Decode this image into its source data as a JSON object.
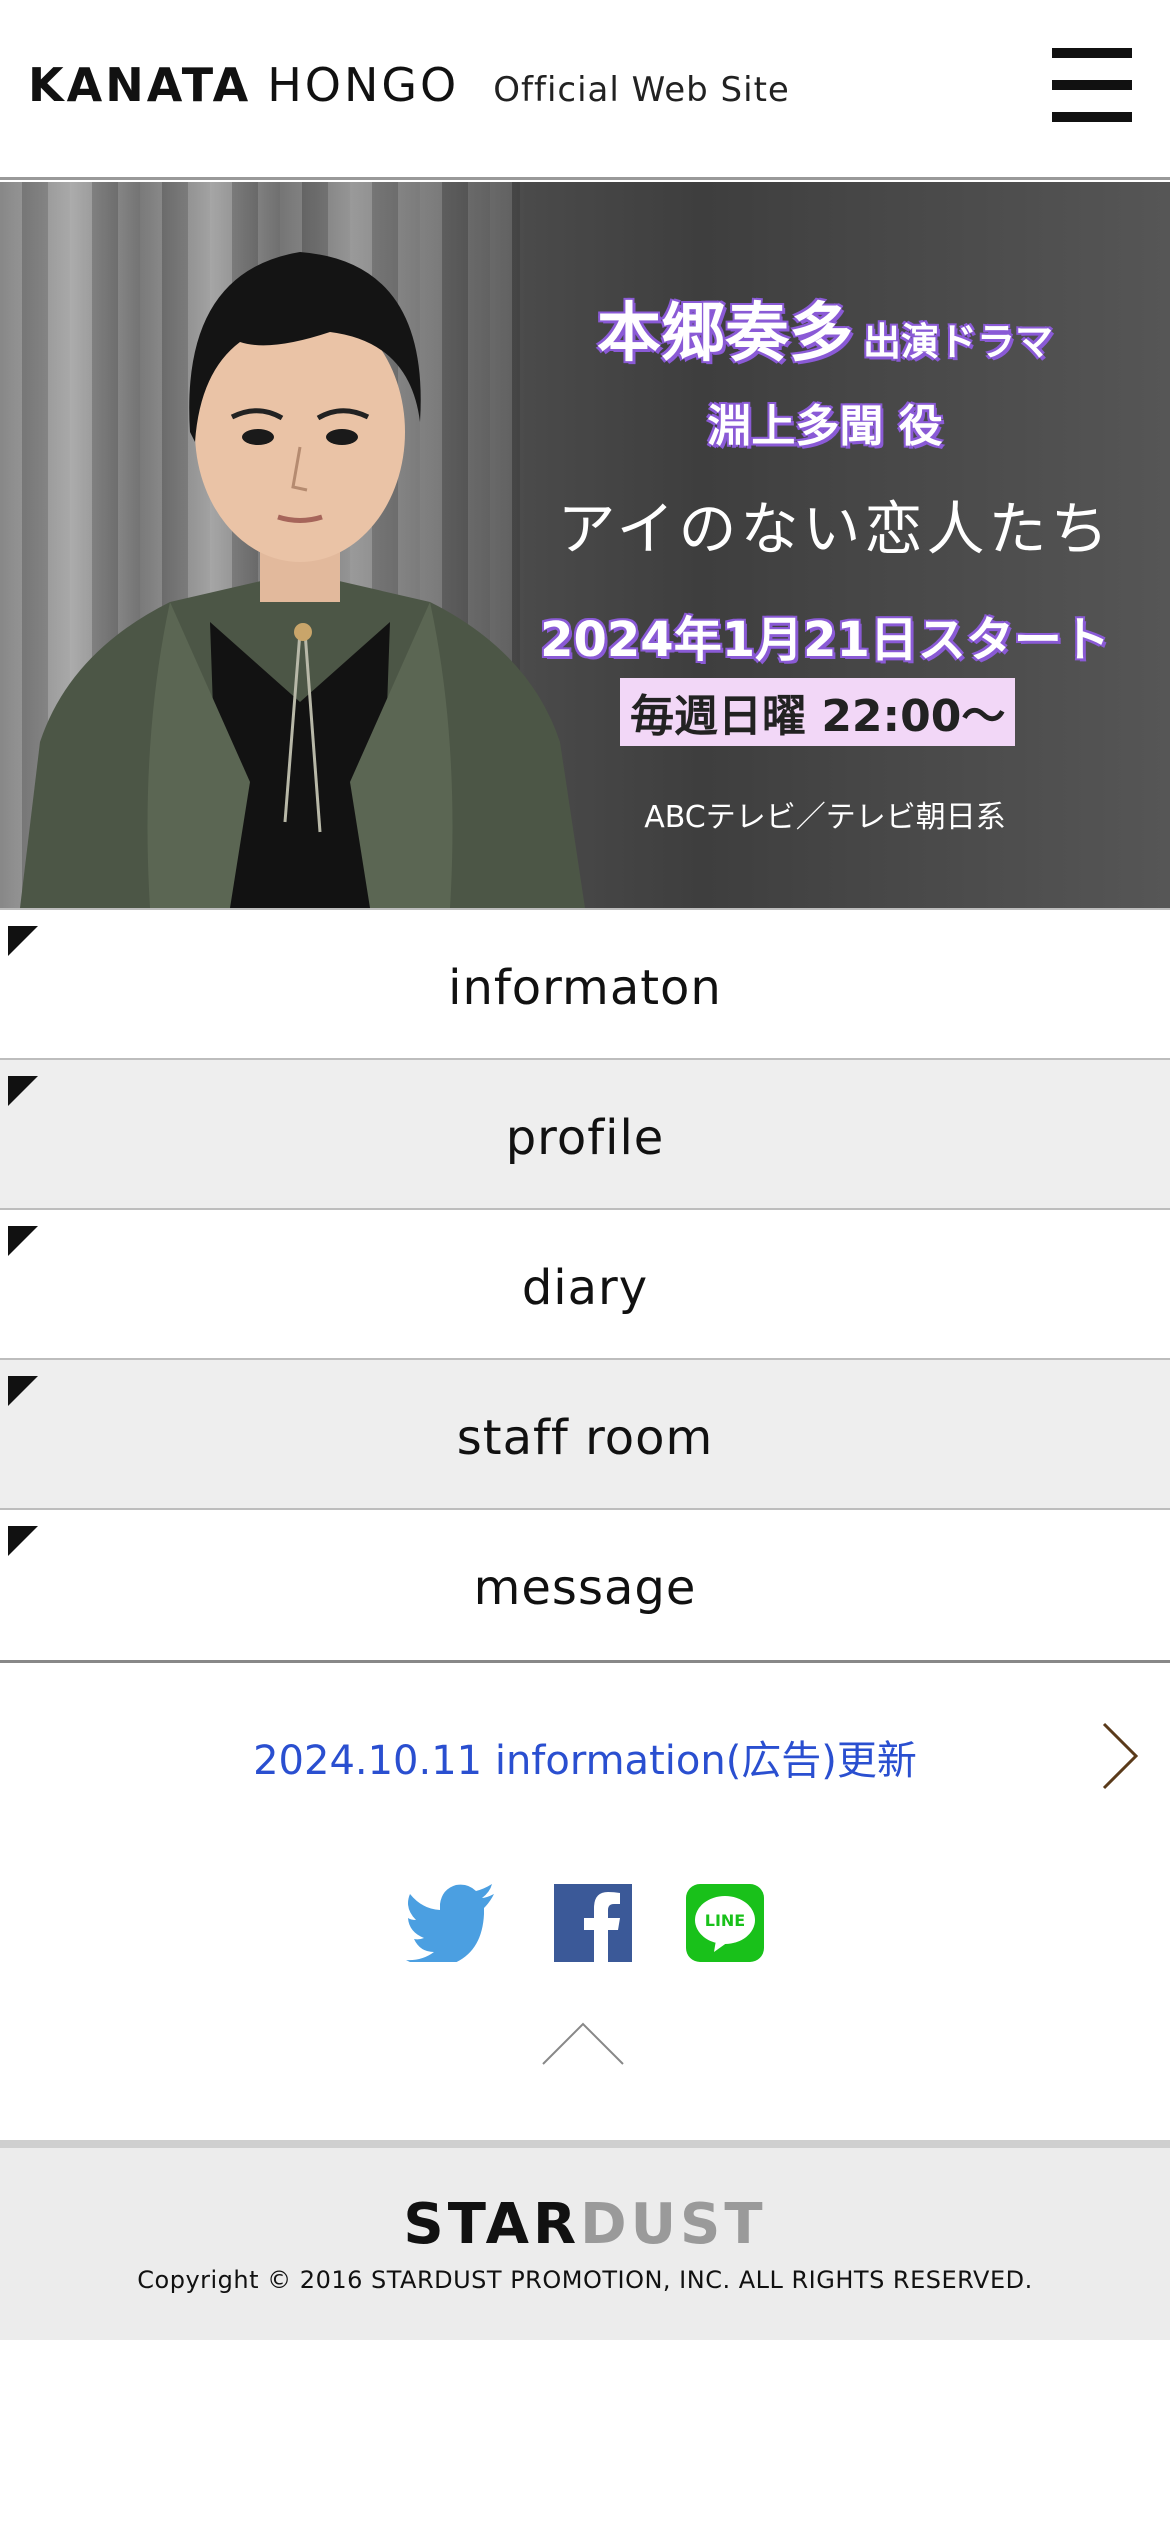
{
  "header": {
    "logo_first": "KANATA",
    "logo_last": "HONGO",
    "logo_sub": "Official Web Site",
    "menu_icon": "hamburger-menu-icon"
  },
  "banner": {
    "name": "本郷奏多",
    "name_suffix": "出演ドラマ",
    "role": "淵上多聞 役",
    "drama_title": "アイのない恋人たち",
    "start": "2024年1月21日スタート",
    "airtime": "毎週日曜 22:00〜",
    "network": "ABCテレビ／テレビ朝日系",
    "accent_color": "#8a5ad6"
  },
  "nav": {
    "items": [
      {
        "label": "informaton"
      },
      {
        "label": "profile"
      },
      {
        "label": "diary"
      },
      {
        "label": "staff room"
      },
      {
        "label": "message"
      }
    ],
    "corner_icon": "triangle-corner-icon"
  },
  "news": {
    "text": "2024.10.11 information(広告)更新",
    "color": "#2a4fd0",
    "arrow_icon": "chevron-right-icon"
  },
  "social": {
    "twitter_icon": "twitter-bird-icon",
    "facebook_icon": "facebook-icon",
    "line_icon": "line-icon",
    "line_text": "LINE",
    "twitter_color": "#4b9fe1",
    "facebook_color": "#3b5998",
    "line_color": "#19c11a"
  },
  "pagetop_icon": "chevron-up-icon",
  "footer": {
    "brand_star": "STAR",
    "brand_dust": "DUST",
    "copyright": "Copyright © 2016 STARDUST PROMOTION, INC. ALL RIGHTS RESERVED."
  }
}
